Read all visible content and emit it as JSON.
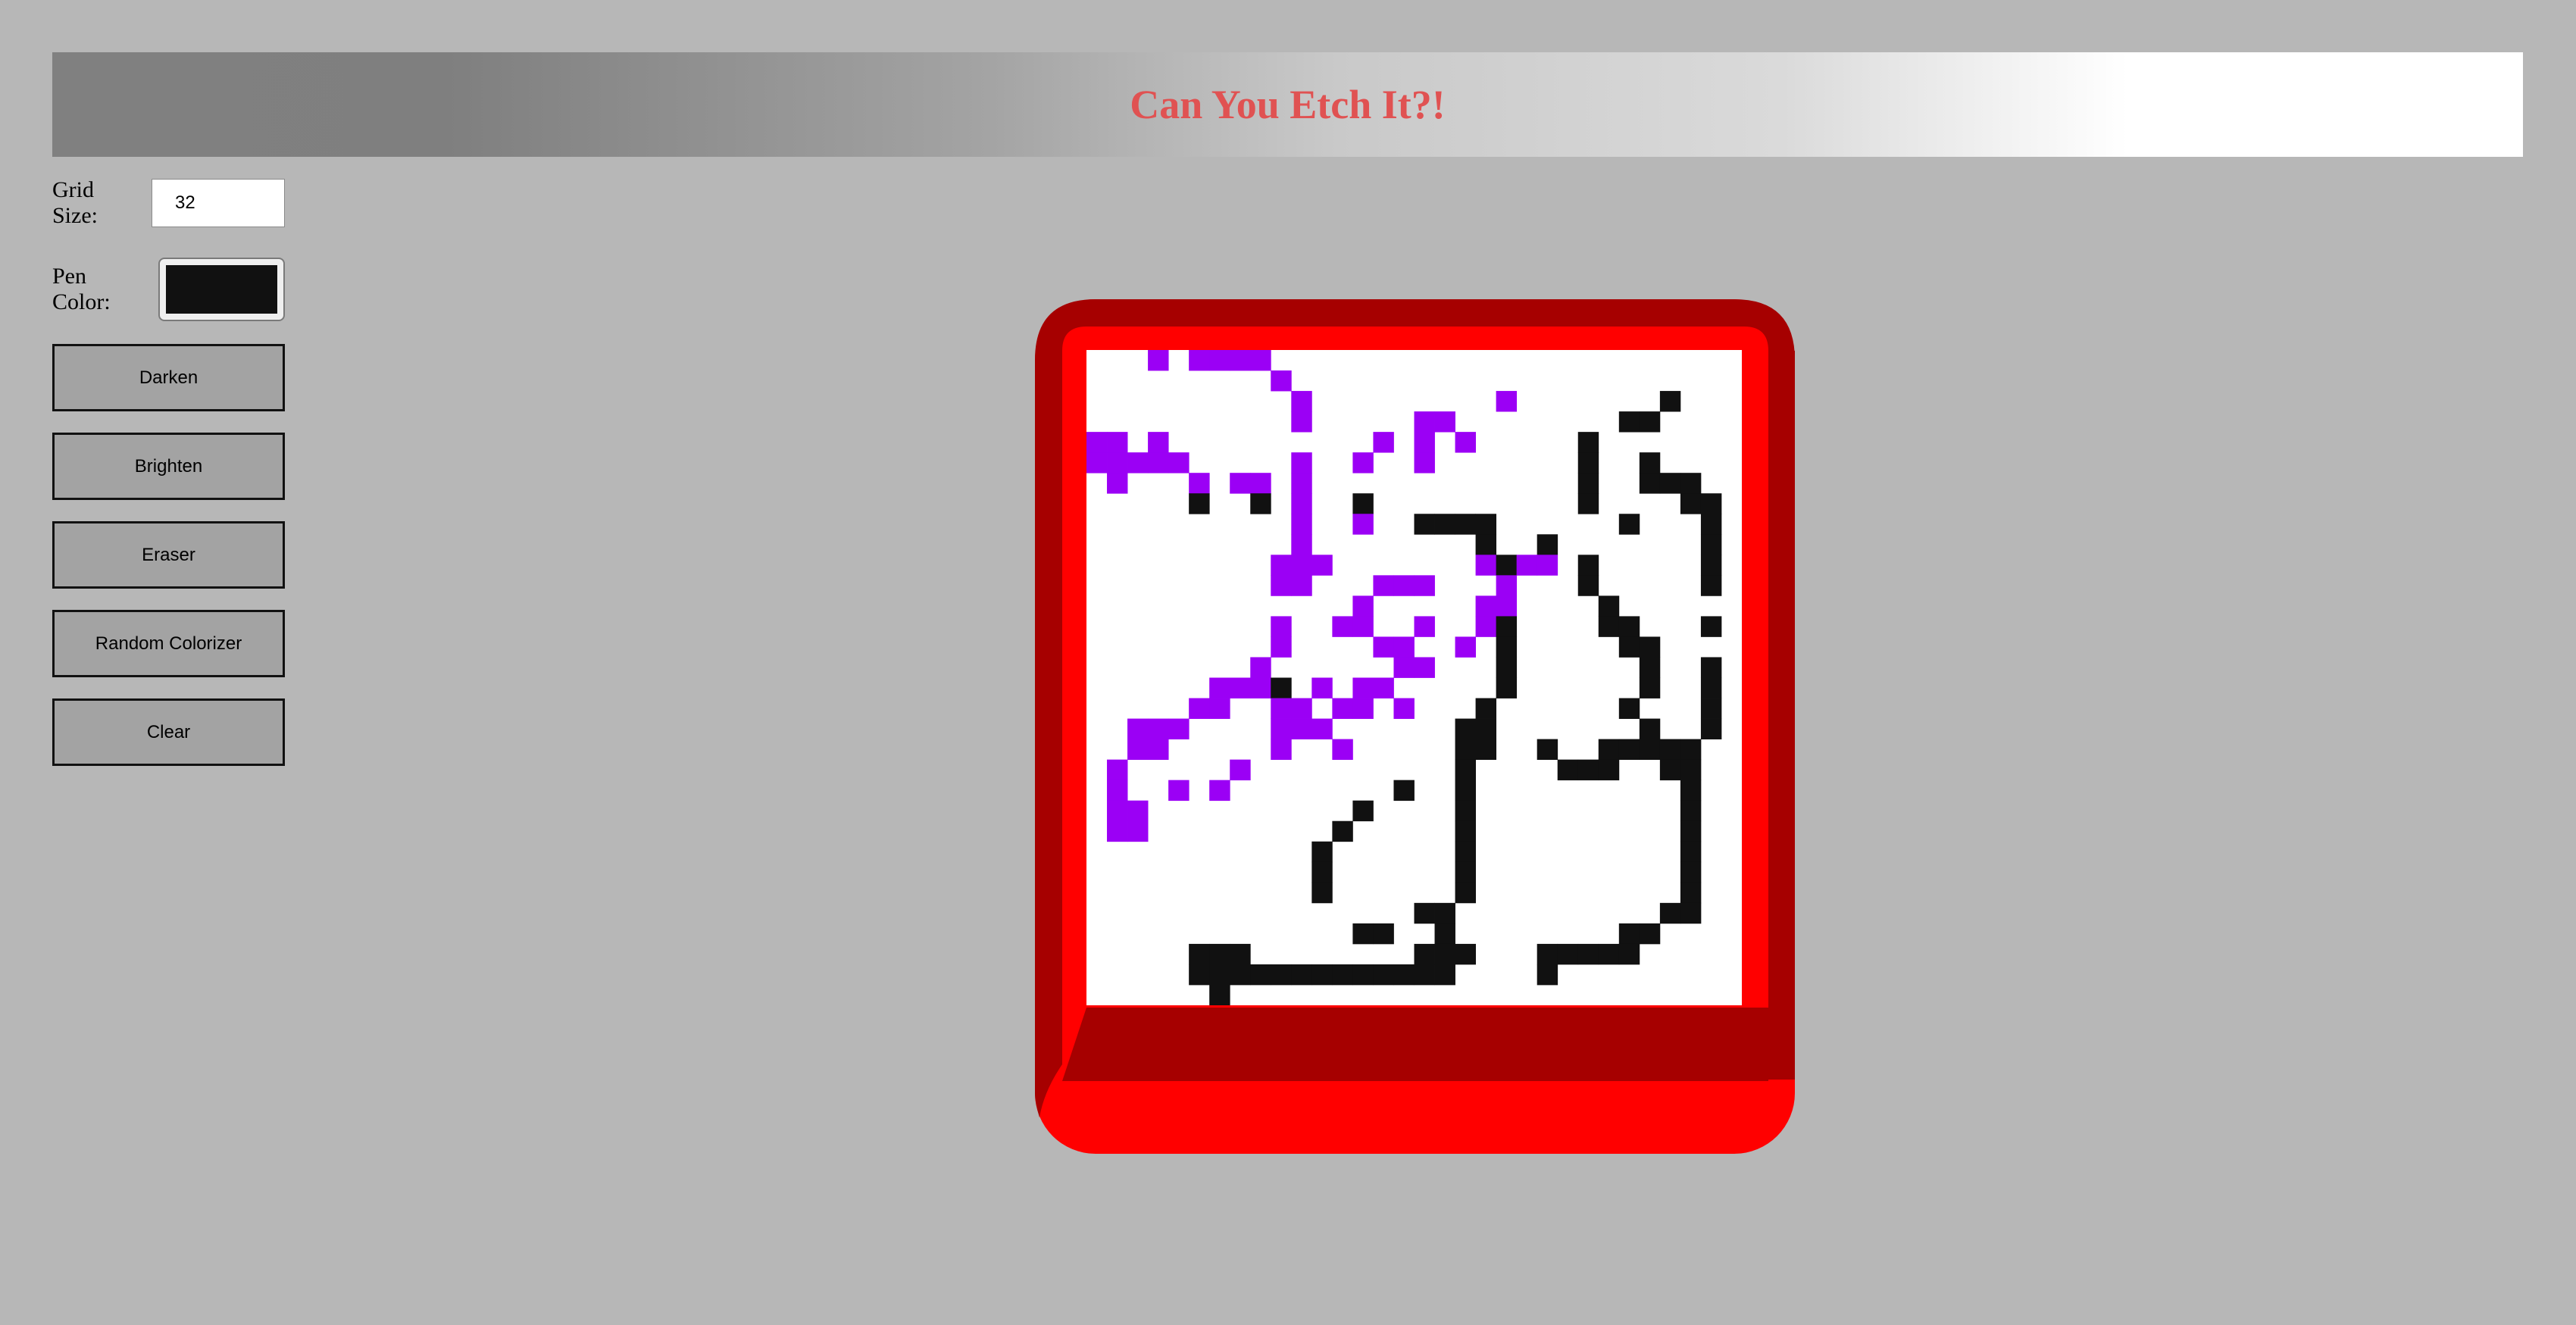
{
  "header": {
    "title": "Can You Etch It?!"
  },
  "controls": {
    "grid_size_label": "Grid Size:",
    "grid_size_value": "32",
    "pen_color_label": "Pen Color:",
    "pen_color": "#111111",
    "buttons": [
      "Darken",
      "Brighten",
      "Eraser",
      "Random Colorizer",
      "Clear"
    ]
  },
  "etch_a_sketch": {
    "frame_color": "#ff0000",
    "frame_shade_color": "#a60000",
    "screen_color": "#ffffff",
    "grid_size": 32,
    "colors": {
      "P": "#9b00f5",
      "K": "#111111"
    },
    "pixels": [
      "   P PPPP                       ",
      "         P                      ",
      "          P         P       K    ",
      "          P     PP        KK     ",
      "PP P          P P P     K        ",
      "PPPPP     P  P  P       K  K    ",
      " P   P PP P             K  KKK  ",
      "     K  K P  K          K    KK ",
      "          P  P  KKKK      K   K ",
      "          P        K  K       K ",
      "         PPP       PKPP K     K ",
      "         PP   PPP   P   K     K ",
      "             P     PP    K      ",
      "         P  PP  P  PK    KK   K ",
      "         P    PP  P K     KK    ",
      "        P      PP   K      K  K ",
      "      PPPK P PP     K      K  K ",
      "     PP  PP PP P   K      K   K ",
      "  PPP    PPP      KK       K  K ",
      "  PP     P  P     KK  K  KKKKK  ",
      " P     P          K    KKK  KK  ",
      " P  P P        K  K          K  ",
      " PP          K    K          K  ",
      " PP         K     K          K  ",
      "           K      K          K  ",
      "           K      K          K  ",
      "           K      K          K  ",
      "                KK          KK  ",
      "             KK  K        KK    ",
      "     KKK        KKK   KKKKK     ",
      "     KKKKKKKKKKKKK    K         ",
      "      K                         "
    ]
  }
}
